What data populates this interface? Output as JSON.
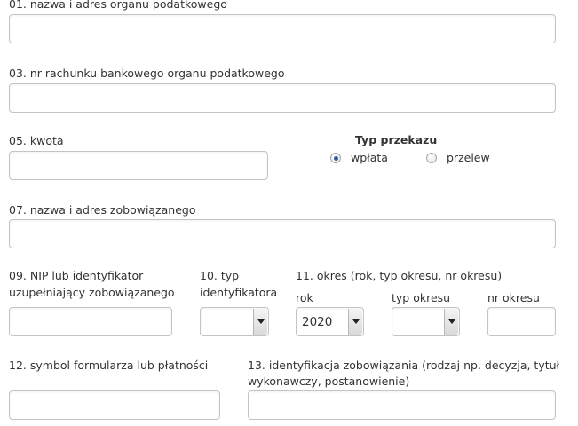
{
  "fields": {
    "f01": {
      "label": "01. nazwa i adres organu podatkowego",
      "value": ""
    },
    "f03": {
      "label": "03. nr rachunku bankowego organu podatkowego",
      "value": ""
    },
    "f05": {
      "label": "05. kwota",
      "value": ""
    },
    "f07": {
      "label": "07. nazwa i adres zobowiązanego",
      "value": ""
    },
    "f09": {
      "label_line1": "09. NIP lub identyfikator",
      "label_line2": "uzupełniający zobowiązanego",
      "value": ""
    },
    "f10": {
      "label_line1": "10. typ",
      "label_line2": "identyfikatora",
      "selected": ""
    },
    "f11": {
      "label": "11. okres (rok, typ okresu, nr okresu)",
      "rok_label": "rok",
      "rok_selected": "2020",
      "typ_okresu_label": "typ okresu",
      "typ_okresu_selected": "",
      "nr_okresu_label": "nr okresu",
      "nr_okresu_value": ""
    },
    "f12": {
      "label": "12. symbol formularza lub płatności",
      "value": ""
    },
    "f13": {
      "label_line1": "13. identyfikacja zobowiązania (rodzaj np. decyzja, tytuł",
      "label_line2": "wykonawczy, postanowienie)",
      "value": ""
    }
  },
  "typ_przekazu": {
    "title": "Typ przekazu",
    "options": [
      {
        "label": "wpłata",
        "checked": true
      },
      {
        "label": "przelew",
        "checked": false
      }
    ]
  },
  "icons": {
    "select_arrow": "triangle-down-icon"
  }
}
